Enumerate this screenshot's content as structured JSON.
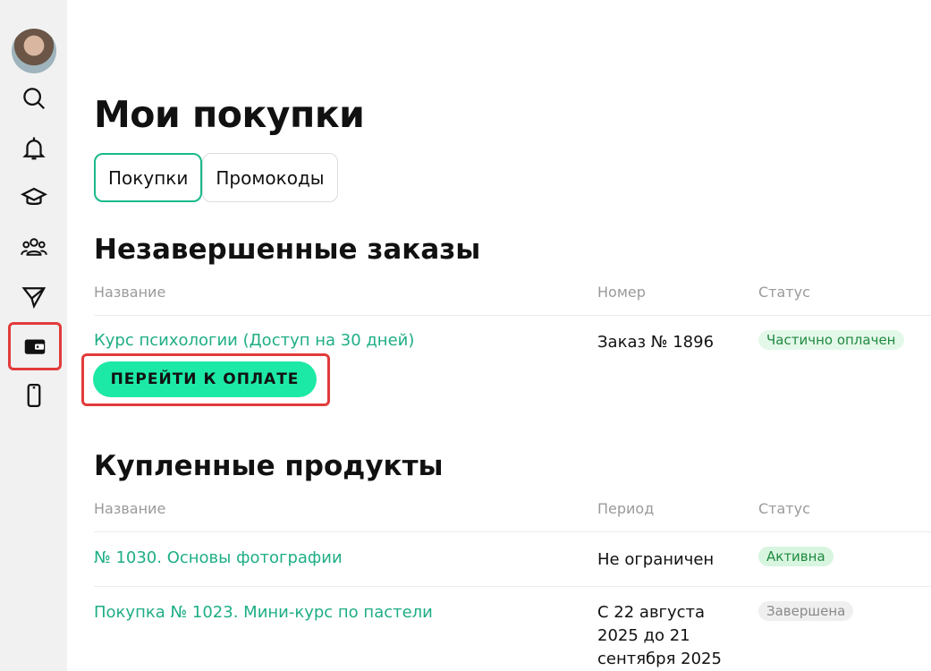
{
  "page": {
    "title": "Мои покупки"
  },
  "tabs": [
    {
      "label": "Покупки"
    },
    {
      "label": "Промокоды"
    }
  ],
  "sidebar": {
    "items": [
      {
        "icon": "search-icon"
      },
      {
        "icon": "bell-icon"
      },
      {
        "icon": "graduation-cap-icon"
      },
      {
        "icon": "users-icon"
      },
      {
        "icon": "send-icon"
      },
      {
        "icon": "wallet-icon"
      },
      {
        "icon": "phone-icon"
      }
    ]
  },
  "unfinished": {
    "title": "Незавершенные заказы",
    "columns": {
      "name": "Название",
      "number": "Номер",
      "status": "Статус"
    },
    "rows": [
      {
        "name": "Курс психологии (Доступ на 30 дней)",
        "number": "Заказ № 1896",
        "status": "Частично оплачен",
        "pay_label": "ПЕРЕЙТИ К ОПЛАТЕ"
      }
    ]
  },
  "purchased": {
    "title": "Купленные продукты",
    "columns": {
      "name": "Название",
      "period": "Период",
      "status": "Статус"
    },
    "rows": [
      {
        "name": "№ 1030. Основы фотографии",
        "period": "Не ограничен",
        "status": "Активна"
      },
      {
        "name": "Покупка № 1023. Мини-курс по пастели",
        "period": "С 22 августа 2025 до 21 сентября 2025",
        "status": "Завершена"
      }
    ]
  },
  "colors": {
    "accent": "#1de9a6",
    "link": "#1fae86",
    "highlight": "#e23b3b"
  }
}
